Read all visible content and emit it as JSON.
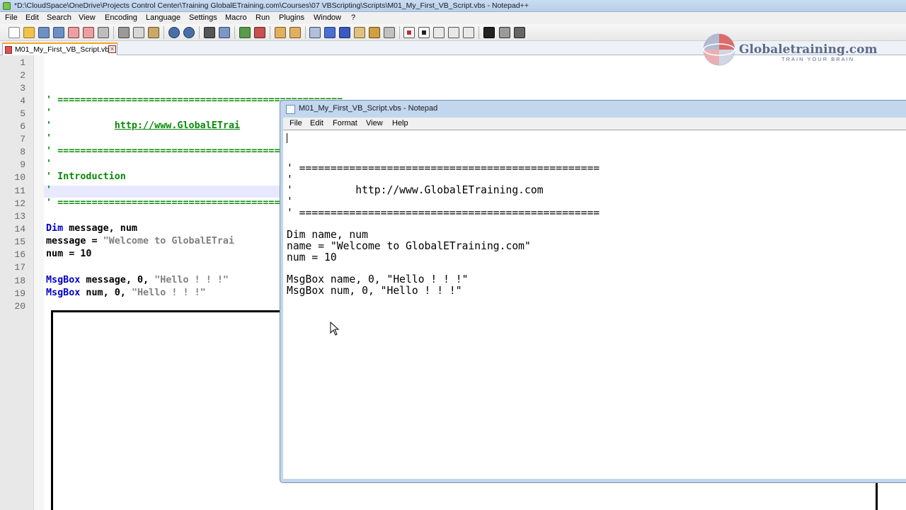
{
  "npp": {
    "window_title": "*D:\\CloudSpace\\OneDrive\\Projects Control Center\\Training GlobalETraining.com\\Courses\\07 VBScripting\\Scripts\\M01_My_First_VB_Script.vbs - Notepad++",
    "menu": [
      "File",
      "Edit",
      "Search",
      "View",
      "Encoding",
      "Language",
      "Settings",
      "Macro",
      "Run",
      "Plugins",
      "Window",
      "?"
    ],
    "tab_label": "M01_My_First_VB_Script.vbs",
    "line_numbers": [
      "1",
      "2",
      "3",
      "4",
      "5",
      "6",
      "7",
      "8",
      "9",
      "10",
      "11",
      "12",
      "13",
      "14",
      "15",
      "16",
      "17",
      "18",
      "19",
      "20"
    ],
    "code": {
      "l4": "' ==================================================",
      "l5": "'",
      "l6_prefix": "'           ",
      "l6_url": "http://www.GlobalETrai",
      "l7": "'",
      "l8": "' ==================================================",
      "l9": "'",
      "l10": "' Introduction",
      "l11": "'",
      "l12": "' ==================================================",
      "l14_kw": "Dim",
      "l14_rest": " message, num",
      "l15_left": "message = ",
      "l15_str": "\"Welcome to GlobalETrai",
      "l16": "num = 10",
      "l18_kw": "MsgBox",
      "l18_rest": " message, 0, ",
      "l18_str": "\"Hello ! ! !\"",
      "l19_kw": "MsgBox",
      "l19_rest": " num, 0, ",
      "l19_str": "\"Hello ! ! !\""
    }
  },
  "logo": {
    "text": "Globaletraining.com",
    "tagline": "TRAIN YOUR BRAIN"
  },
  "notepad": {
    "title": "M01_My_First_VB_Script.vbs - Notepad",
    "menu": [
      "File",
      "Edit",
      "Format",
      "View",
      "Help"
    ],
    "lines": [
      "",
      "",
      "' ================================================",
      "'",
      "'          http://www.GlobalETraining.com",
      "'",
      "' ================================================",
      "",
      "Dim name, num",
      "name = \"Welcome to GlobalETraining.com\"",
      "num = 10",
      "",
      "MsgBox name, 0, \"Hello ! ! !\"",
      "MsgBox num, 0, \"Hello ! ! !\""
    ]
  },
  "icons": [
    "new-file-icon",
    "open-icon",
    "save-icon",
    "save-all-icon",
    "close-icon",
    "close-all-icon",
    "print-icon",
    "cut-icon",
    "copy-icon",
    "paste-icon",
    "undo-icon",
    "redo-icon",
    "find-icon",
    "replace-icon",
    "zoom-in-icon",
    "zoom-out-icon",
    "sync-v-icon",
    "sync-h-icon",
    "word-wrap-icon",
    "all-chars-icon",
    "indent-guide-icon",
    "lang-icon",
    "doc-map-icon",
    "function-list-icon",
    "folder-workspace-icon",
    "record-macro-icon",
    "stop-macro-icon",
    "play-macro-icon",
    "run-macro-multiple-icon",
    "save-macro-icon",
    "spell-check-icon",
    "compare-icon",
    "settings-icon"
  ]
}
